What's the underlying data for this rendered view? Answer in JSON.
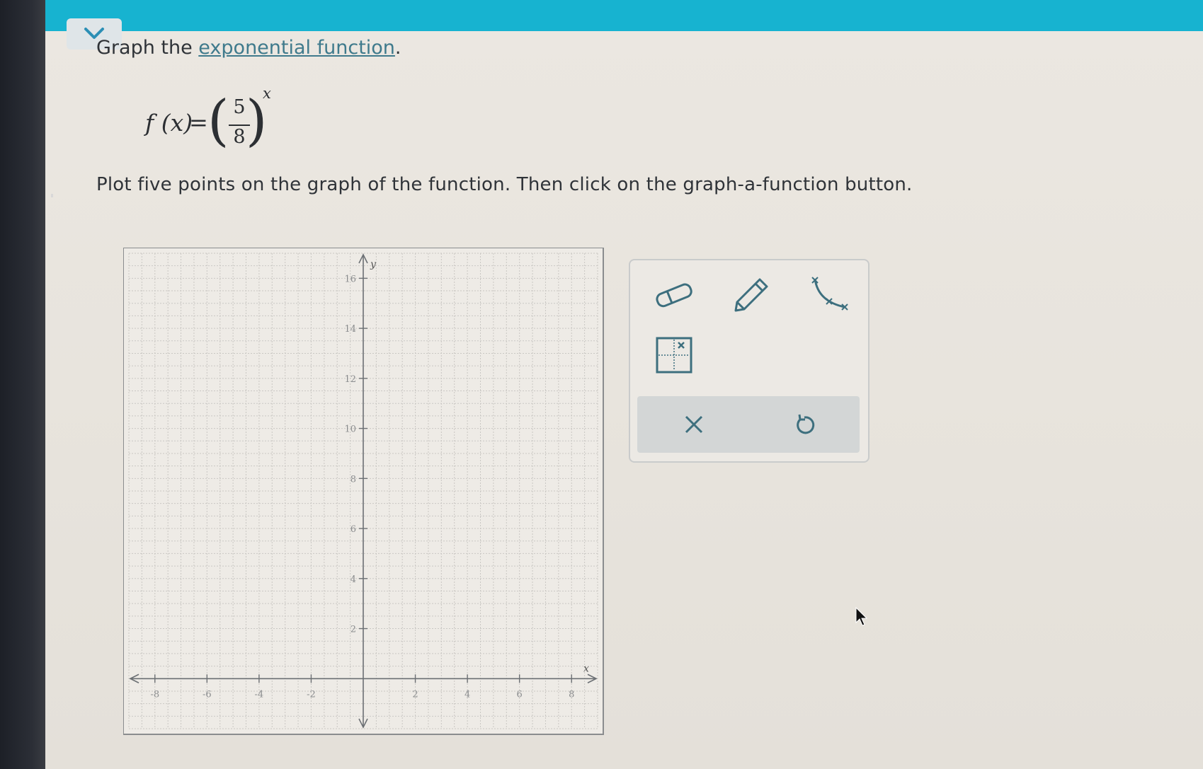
{
  "question": {
    "prefix": "Graph the ",
    "link_text": "exponential function",
    "suffix": "."
  },
  "formula": {
    "lhs": "f (x)",
    "equals": "=",
    "numerator": "5",
    "denominator": "8",
    "exponent": "x"
  },
  "instruction": "Plot five points on the graph of the function. Then click on the graph-a-function button.",
  "graph": {
    "x_axis_label": "x",
    "y_axis_label": "y",
    "x_ticks": [
      -8,
      -6,
      -4,
      -2,
      2,
      4,
      6,
      8
    ],
    "y_ticks": [
      2,
      4,
      6,
      8,
      10,
      12,
      14,
      16
    ],
    "x_range": [
      -9,
      9
    ],
    "y_range": [
      -2,
      17
    ]
  },
  "toolbox": {
    "tools": [
      {
        "name": "eraser",
        "icon": "eraser-icon"
      },
      {
        "name": "pencil",
        "icon": "pencil-icon"
      },
      {
        "name": "graph-a-function",
        "icon": "exponential-curve-icon"
      },
      {
        "name": "point-plot",
        "icon": "point-grid-icon"
      }
    ],
    "actions": [
      {
        "name": "clear",
        "icon": "close-icon"
      },
      {
        "name": "undo",
        "icon": "undo-icon"
      }
    ]
  },
  "colors": {
    "top_bar": "#17b3d0",
    "link": "#3f7a8c",
    "tool_icon": "#3d6f7e"
  }
}
